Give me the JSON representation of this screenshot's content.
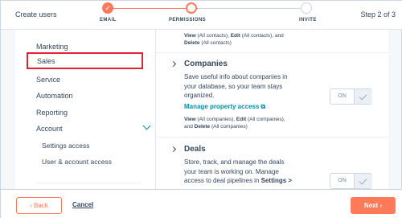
{
  "header": {
    "title": "Create users",
    "step_indicator": "Step 2 of 3",
    "steps": [
      {
        "label": "EMAIL",
        "state": "done"
      },
      {
        "label": "PERMISSIONS",
        "state": "current"
      },
      {
        "label": "INVITE",
        "state": "future"
      }
    ],
    "done_check": "✓"
  },
  "sidebar": {
    "items": {
      "marketing": "Marketing",
      "sales": "Sales",
      "service": "Service",
      "automation": "Automation",
      "reporting": "Reporting",
      "account": "Account",
      "settings_access": "Settings access",
      "user_account_access": "User & account access"
    },
    "selected": "Sales"
  },
  "main": {
    "top_perm": {
      "line1_view": "View",
      "line1_view_scope": " (All contacts), ",
      "line1_edit": "Edit",
      "line1_edit_scope": " (All contacts), and",
      "line2_delete": "Delete",
      "line2_delete_scope": " (All contacts)"
    },
    "companies": {
      "title": "Companies",
      "description": "Save useful info about companies in your database, so your team stays organized.",
      "link": "Manage property access",
      "toggle_label": "ON",
      "perm_line1_view": "View",
      "perm_line1_view_scope": " (All companies), ",
      "perm_line1_edit": "Edit",
      "perm_line1_edit_scope": " (All companies),",
      "perm_line2_and": "and ",
      "perm_line2_delete": "Delete",
      "perm_line2_delete_scope": " (All companies)"
    },
    "deals": {
      "title": "Deals",
      "description_main": "Store, track, and manage the deals your team is working on. Manage access to deal pipelines in ",
      "description_link": "Settings >",
      "toggle_label": "ON"
    }
  },
  "footer": {
    "back_label": "Back",
    "back_icon": "‹",
    "cancel_label": "Cancel",
    "next_label": "Next",
    "next_icon": "›"
  },
  "colors": {
    "accent": "#ff7a59",
    "link": "#0091ae",
    "text": "#33475b",
    "selection_outline": "#e52233"
  }
}
